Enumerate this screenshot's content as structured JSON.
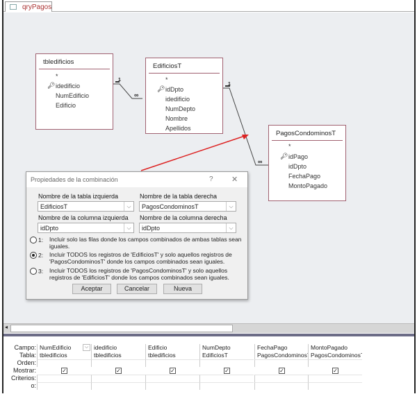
{
  "tab": {
    "label": "qryPagos"
  },
  "tables": [
    {
      "name": "tbledificios",
      "fields": [
        "*",
        "idedificio",
        "NumEdificio",
        "Edificio"
      ],
      "key_index": 1
    },
    {
      "name": "EdificiosT",
      "fields": [
        "*",
        "idDpto",
        "idedificio",
        "NumDepto",
        "Nombre",
        "Apellidos"
      ],
      "key_index": 1
    },
    {
      "name": "PagosCondominosT",
      "fields": [
        "*",
        "idPago",
        "idDpto",
        "FechaPago",
        "MontoPagado"
      ],
      "key_index": 1
    }
  ],
  "relations": {
    "one": "1",
    "many": "∞"
  },
  "dialog": {
    "title": "Propiedades de la combinación",
    "help": "?",
    "close": "✕",
    "left_table_label": "Nombre de la tabla izquierda",
    "left_table": "EdificiosT",
    "right_table_label": "Nombre de la tabla derecha",
    "right_table": "PagosCondominosT",
    "left_col_label": "Nombre de la columna izquierda",
    "left_col": "idDpto",
    "right_col_label": "Nombre de la columna derecha",
    "right_col": "idDpto",
    "options": [
      {
        "num": "1:",
        "text": "Incluir solo las filas donde los campos combinados de ambas tablas sean iguales.",
        "selected": false
      },
      {
        "num": "2:",
        "text": "Incluir TODOS los registros de 'EdificiosT' y solo aquellos registros de 'PagosCondominosT' donde los campos combinados sean iguales.",
        "selected": true
      },
      {
        "num": "3:",
        "text": "Incluir TODOS los registros de 'PagosCondominosT' y solo aquellos registros de 'EdificiosT' donde los campos combinados sean iguales.",
        "selected": false
      }
    ],
    "ok": "Aceptar",
    "cancel": "Cancelar",
    "new": "Nueva"
  },
  "grid": {
    "row_labels": [
      "Campo:",
      "Tabla:",
      "Orden:",
      "Mostrar:",
      "Criterios:",
      "o:"
    ],
    "columns": [
      {
        "field": "NumEdificio",
        "table": "tbledificios",
        "show": true
      },
      {
        "field": "idedificio",
        "table": "tbledificios",
        "show": true
      },
      {
        "field": "Edificio",
        "table": "tbledificios",
        "show": true
      },
      {
        "field": "NumDepto",
        "table": "EdificiosT",
        "show": true
      },
      {
        "field": "FechaPago",
        "table": "PagosCondominosT",
        "show": true
      },
      {
        "field": "MontoPagado",
        "table": "PagosCondominosT",
        "show": true
      }
    ]
  },
  "colors": {
    "accent_red": "#d22",
    "table_border": "#a06070"
  }
}
